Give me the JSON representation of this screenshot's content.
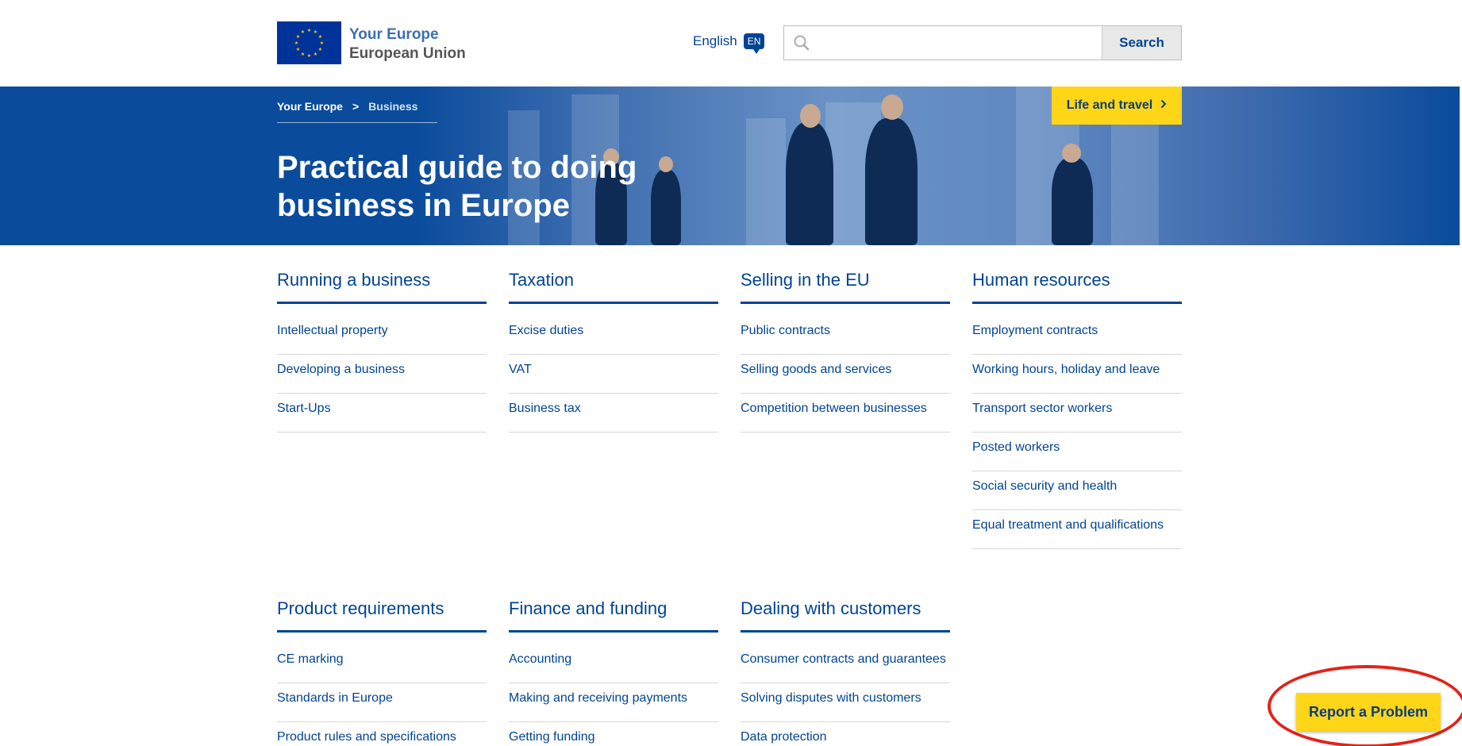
{
  "header": {
    "logo_title": "Your Europe",
    "logo_subtitle": "European Union",
    "language_label": "English",
    "language_code": "EN",
    "search_placeholder": "",
    "search_button": "Search"
  },
  "hero": {
    "breadcrumb": [
      "Your Europe",
      ">",
      "Business"
    ],
    "title": "Practical guide to doing business in Europe",
    "life_button": "Life and travel"
  },
  "sections": [
    {
      "title": "Running a business",
      "links": [
        "Intellectual property",
        "Developing a business",
        "Start-Ups"
      ]
    },
    {
      "title": "Taxation",
      "links": [
        "Excise duties",
        "VAT",
        "Business tax"
      ]
    },
    {
      "title": "Selling in the EU",
      "links": [
        "Public contracts",
        "Selling goods and services",
        "Competition between businesses"
      ]
    },
    {
      "title": "Human resources",
      "links": [
        "Employment contracts",
        "Working hours, holiday and leave",
        "Transport sector workers",
        "Posted workers",
        "Social security and health",
        "Equal treatment and qualifications"
      ]
    },
    {
      "title": "Product requirements",
      "links": [
        "CE marking",
        "Standards in Europe",
        "Product rules and specifications"
      ]
    },
    {
      "title": "Finance and funding",
      "links": [
        "Accounting",
        "Making and receiving payments",
        "Getting funding"
      ]
    },
    {
      "title": "Dealing with customers",
      "links": [
        "Consumer contracts and guarantees",
        "Solving disputes with customers",
        "Data protection"
      ]
    }
  ],
  "report_button": "Report a Problem",
  "colors": {
    "primary": "#004494",
    "accent": "#ffd617",
    "highlight_circle": "#e32219"
  }
}
